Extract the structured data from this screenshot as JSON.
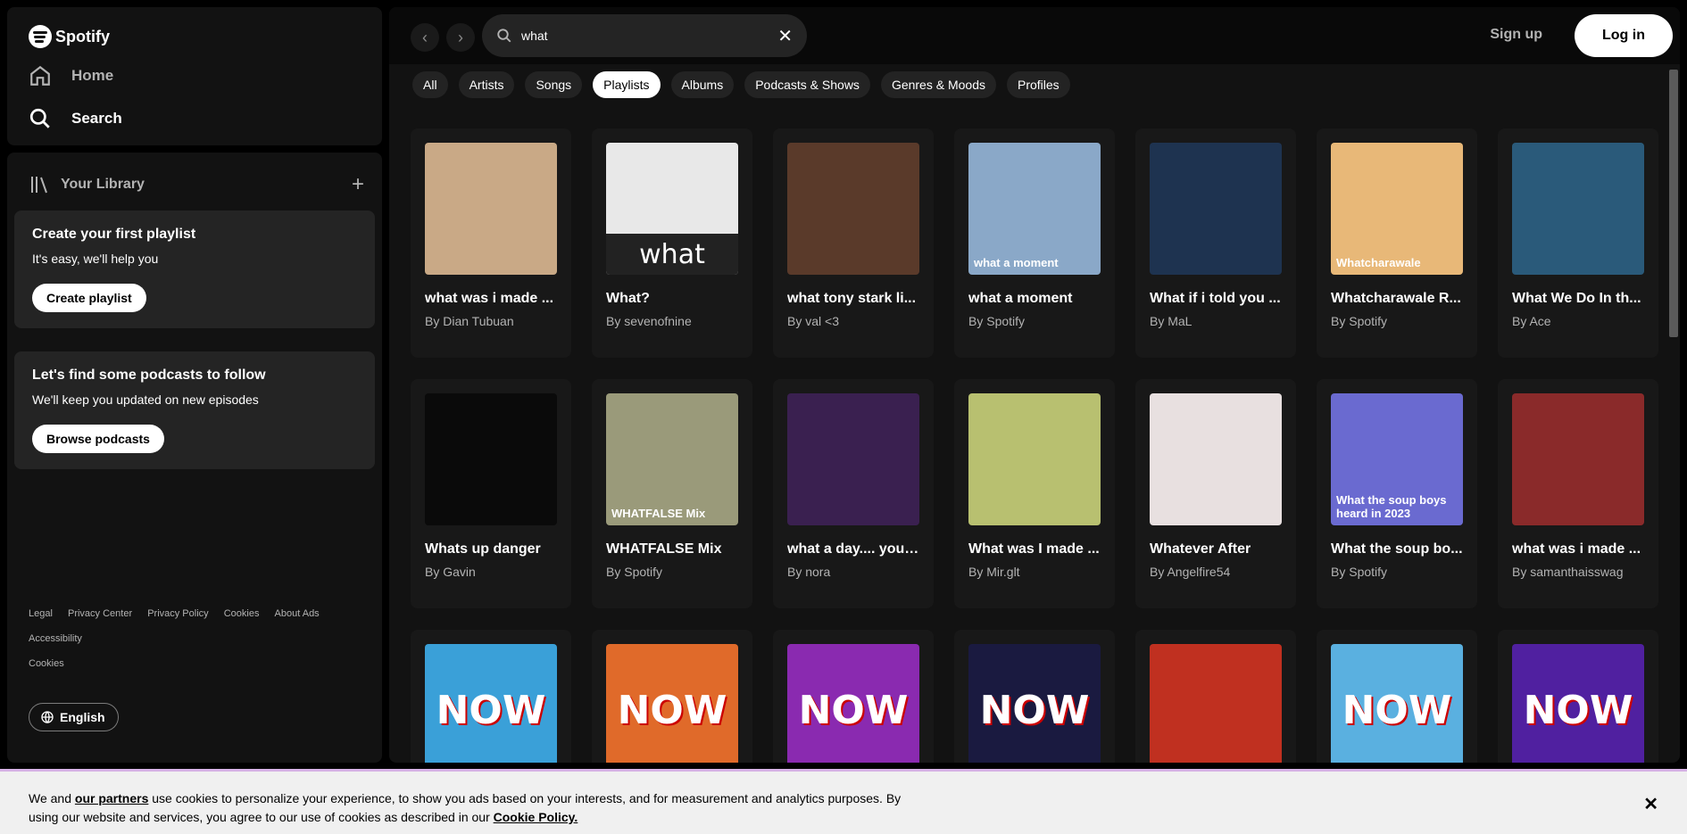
{
  "brand": {
    "name": "Spotify"
  },
  "nav": {
    "home": "Home",
    "search": "Search"
  },
  "library": {
    "title": "Your Library",
    "promo_playlist": {
      "title": "Create your first playlist",
      "subtitle": "It's easy, we'll help you",
      "button": "Create playlist"
    },
    "promo_podcasts": {
      "title": "Let's find some podcasts to follow",
      "subtitle": "We'll keep you updated on new episodes",
      "button": "Browse podcasts"
    },
    "legal": [
      "Legal",
      "Privacy Center",
      "Privacy Policy",
      "Cookies",
      "About Ads",
      "Accessibility",
      "Cookies"
    ],
    "language": "English"
  },
  "topbar": {
    "search_value": "what",
    "signup": "Sign up",
    "login": "Log in"
  },
  "filters": [
    "All",
    "Artists",
    "Songs",
    "Playlists",
    "Albums",
    "Podcasts & Shows",
    "Genres & Moods",
    "Profiles"
  ],
  "active_filter": "Playlists",
  "cards": [
    {
      "title": "what was i made ...",
      "subtitle": "By Dian Tubuan",
      "color": "#c9a986",
      "overlay": ""
    },
    {
      "title": "What?",
      "subtitle": "By sevenofnine",
      "color": "#e8e8e8",
      "overlay": "what"
    },
    {
      "title": "what tony stark li...",
      "subtitle": "By val <3",
      "color": "#5a3a2a",
      "overlay": ""
    },
    {
      "title": "what a moment",
      "subtitle": "By Spotify",
      "color": "#8aa8c8",
      "overlay": "what a moment"
    },
    {
      "title": "What if i told you ...",
      "subtitle": "By MaL",
      "color": "#1e3350",
      "overlay": ""
    },
    {
      "title": "Whatcharawale R...",
      "subtitle": "By Spotify",
      "color": "#e8b878",
      "overlay": "Whatcharawale"
    },
    {
      "title": "What We Do In th...",
      "subtitle": "By Ace",
      "color": "#2a5a7a",
      "overlay": ""
    },
    {
      "title": "Whats up danger",
      "subtitle": "By Gavin",
      "color": "#0a0a0a",
      "overlay": ""
    },
    {
      "title": "WHATFALSE Mix",
      "subtitle": "By Spotify",
      "color": "#9a9a7a",
      "overlay": "WHATFALSE Mix"
    },
    {
      "title": "what a day.... you ...",
      "subtitle": "By nora",
      "color": "#3a2050",
      "overlay": ""
    },
    {
      "title": "What was I made ...",
      "subtitle": "By Mir.glt",
      "color": "#b8c070",
      "overlay": ""
    },
    {
      "title": "Whatever After",
      "subtitle": "By Angelfire54",
      "color": "#e8e0e0",
      "overlay": ""
    },
    {
      "title": "What the soup bo...",
      "subtitle": "By Spotify",
      "color": "#6a6ad0",
      "overlay": "What the soup boys heard in 2023"
    },
    {
      "title": "what was i made ...",
      "subtitle": "By samanthaisswag",
      "color": "#8a2a2a",
      "overlay": ""
    },
    {
      "title": "",
      "subtitle": "",
      "color": "#3aa0d8",
      "overlay": "NOW"
    },
    {
      "title": "",
      "subtitle": "",
      "color": "#e06a2a",
      "overlay": "NOW"
    },
    {
      "title": "",
      "subtitle": "",
      "color": "#8a2ab0",
      "overlay": "NOW"
    },
    {
      "title": "",
      "subtitle": "",
      "color": "#1a1a40",
      "overlay": "NOW"
    },
    {
      "title": "",
      "subtitle": "",
      "color": "#c03020",
      "overlay": ""
    },
    {
      "title": "",
      "subtitle": "",
      "color": "#5ab0e0",
      "overlay": "NOW"
    },
    {
      "title": "",
      "subtitle": "",
      "color": "#5020a0",
      "overlay": "NOW"
    }
  ],
  "cookie": {
    "text_before": "We and ",
    "link_partners": "our partners",
    "text_after": " use cookies to personalize your experience, to show you ads based on your interests, and for measurement and analytics purposes. By using our website and services, you agree to our use of cookies as described in our ",
    "link_policy": "Cookie Policy."
  }
}
